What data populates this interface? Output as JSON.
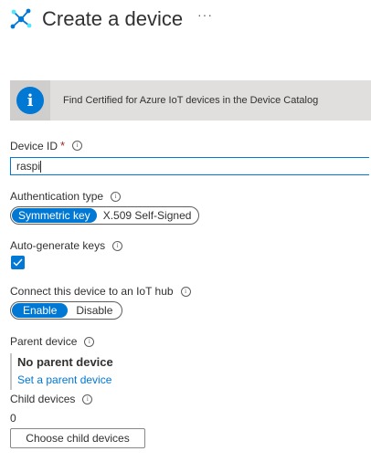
{
  "header": {
    "title": "Create a device",
    "more_label": "···"
  },
  "banner": {
    "icon": "info-icon",
    "icon_glyph": "i",
    "text": "Find Certified for Azure IoT devices in the Device Catalog"
  },
  "device_id": {
    "label": "Device ID",
    "required_mark": "*",
    "value": "raspi"
  },
  "auth_type": {
    "label": "Authentication type",
    "options": [
      "Symmetric key",
      "X.509 Self-Signed"
    ],
    "selected": "Symmetric key"
  },
  "auto_generate": {
    "label": "Auto-generate keys",
    "checked": true
  },
  "connect_hub": {
    "label": "Connect this device to an IoT hub",
    "options": [
      "Enable",
      "Disable"
    ],
    "selected": "Enable"
  },
  "parent_device": {
    "label": "Parent device",
    "value": "No parent device",
    "link": "Set a parent device"
  },
  "child_devices": {
    "label": "Child devices",
    "count": "0",
    "button": "Choose child devices"
  },
  "tooltip_glyph": "i",
  "colors": {
    "accent": "#0078d4",
    "banner_bg": "#e1dfdd",
    "required": "#a4262c"
  }
}
